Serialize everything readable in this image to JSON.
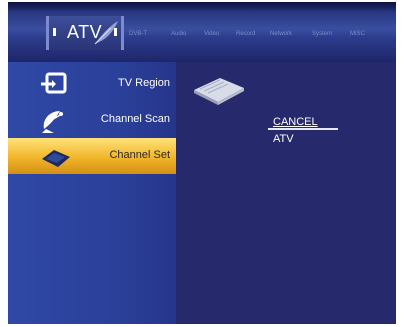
{
  "header": {
    "active_tab": "ATV",
    "tabs": [
      "DVB-T",
      "Audio",
      "Video",
      "Record",
      "Network",
      "System",
      "MISC"
    ]
  },
  "menu": {
    "items": [
      {
        "label": "TV Region",
        "icon": "tv-region-icon",
        "selected": false
      },
      {
        "label": "Channel Scan",
        "icon": "satellite-dish-icon",
        "selected": false
      },
      {
        "label": "Channel Set",
        "icon": "channel-set-icon",
        "selected": true
      }
    ]
  },
  "options": {
    "cancel": "CANCEL",
    "atv": "ATV"
  },
  "colors": {
    "background": "#24276a",
    "menu": "#2a3f98",
    "selected": "#f1b52a"
  }
}
